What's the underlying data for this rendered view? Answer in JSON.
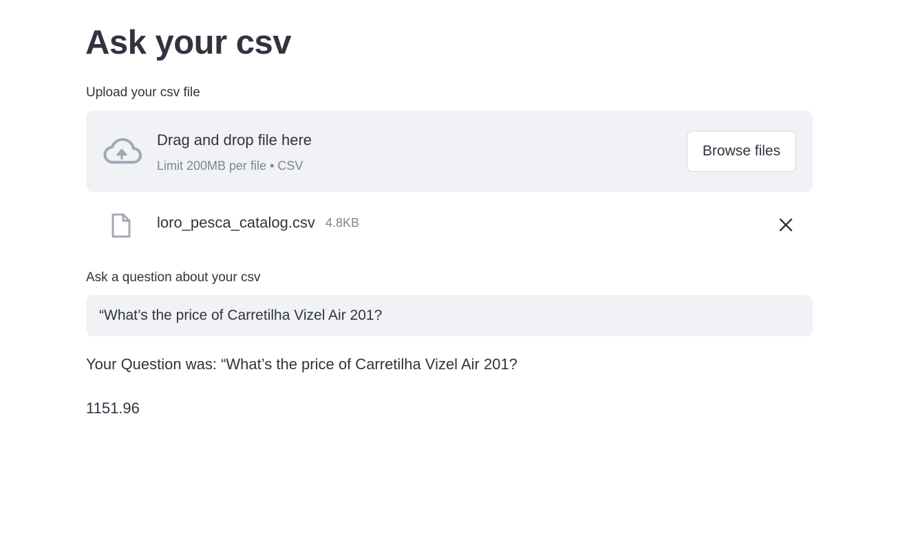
{
  "page": {
    "title": "Ask your csv"
  },
  "uploader": {
    "label": "Upload your csv file",
    "instructions": "Drag and drop file here",
    "limit_text": "Limit 200MB per file • CSV",
    "browse_label": "Browse files",
    "icon": "cloud-upload-icon"
  },
  "uploaded_file": {
    "name": "loro_pesca_catalog.csv",
    "size": "4.8KB",
    "icon": "file-icon",
    "remove_icon": "close-icon"
  },
  "question": {
    "label": "Ask a question about your csv",
    "value": "“What’s the price of Carretilha Vizel Air 201?"
  },
  "result": {
    "question_echo": "Your Question was: “What’s the price of Carretilha Vizel Air 201?",
    "answer": "1151.96"
  },
  "colors": {
    "text": "#31333f",
    "muted": "#808495",
    "panel_bg": "#f0f2f6",
    "icon": "#a3a8b8"
  }
}
